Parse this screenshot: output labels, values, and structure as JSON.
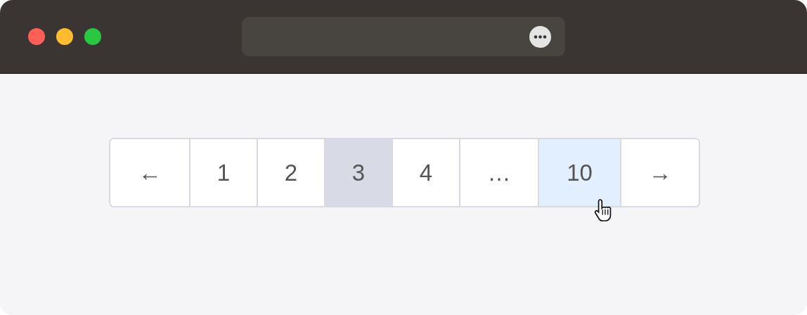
{
  "pagination": [
    {
      "label": "←",
      "selected": false,
      "hovered": false
    },
    {
      "label": "1",
      "selected": false,
      "hovered": false
    },
    {
      "label": "2",
      "selected": false,
      "hovered": false
    },
    {
      "label": "3",
      "selected": true,
      "hovered": false
    },
    {
      "label": "4",
      "selected": false,
      "hovered": false
    },
    {
      "label": "…",
      "selected": false,
      "hovered": false
    },
    {
      "label": "10",
      "selected": false,
      "hovered": true
    },
    {
      "label": "→",
      "selected": false,
      "hovered": false
    }
  ]
}
